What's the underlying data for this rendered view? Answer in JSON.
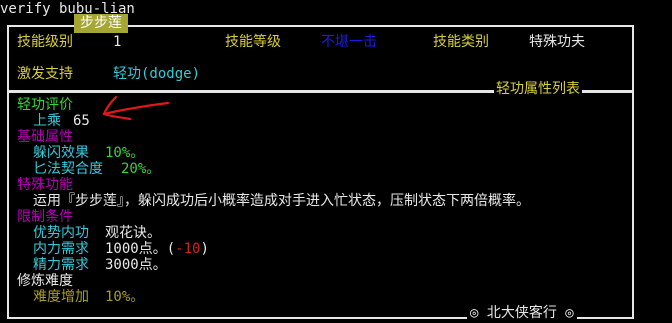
{
  "command": "verify bubu-lian",
  "skill_name": "步步莲",
  "header": {
    "level_label": "技能级别",
    "level_value": "1",
    "grade_label": "技能等级",
    "grade_value": "不堪一击",
    "category_label": "技能类别",
    "category_value": "特殊功夫",
    "trigger_label": "激发支持",
    "trigger_value": "轻功(dodge)"
  },
  "attr_table_title": "轻功属性列表",
  "evaluation": {
    "heading": "轻功评价",
    "rank": "上乘",
    "score": "65"
  },
  "basic": {
    "heading": "基础属性",
    "dodge_label": "躲闪效果",
    "dodge_value": "10%。",
    "dagger_label": "匕法契合度",
    "dagger_value": "20%。"
  },
  "special": {
    "heading": "特殊功能",
    "text": "运用『步步莲』，躲闪成功后小概率造成对手进入忙状态，压制状态下两倍概率。"
  },
  "limits": {
    "heading": "限制条件",
    "advantage_label": "优势内功",
    "advantage_value": "观花诀。",
    "neili_label": "内力需求",
    "neili_value": "1000",
    "neili_unit": "点。",
    "neili_paren_open": "(",
    "neili_delta": "-10",
    "neili_paren_close": ")",
    "jingli_label": "精力需求",
    "jingli_value": "3000",
    "jingli_unit": "点。"
  },
  "difficulty": {
    "heading": "修炼难度",
    "label": "难度增加",
    "value": "10%。"
  },
  "footer": "◎ 北大侠客行 ◎",
  "colors": {
    "background": "#000000",
    "title_tab": "#a6a633",
    "label_yellow": "#d8cf3c",
    "value_cyan": "#39c8d8",
    "green": "#36d636",
    "purple": "#b000b0",
    "olive": "#a89e22",
    "red": "#d02020",
    "blue": "#1c1ce0",
    "annotation_red": "#e01818"
  }
}
